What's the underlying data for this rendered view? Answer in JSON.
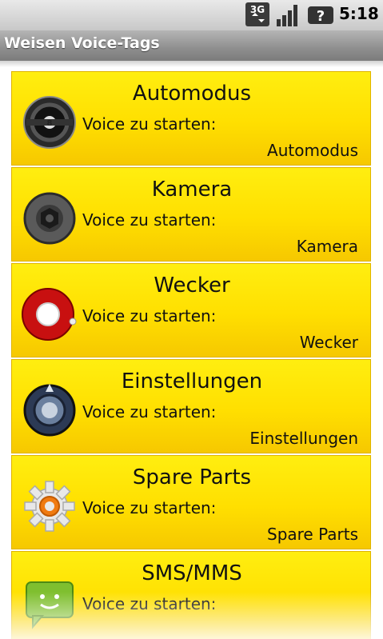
{
  "status_bar": {
    "network_icon": "3g-icon",
    "signal_icon": "signal-strength-icon",
    "unknown_icon": "question-mark-icon",
    "time": "5:18"
  },
  "app": {
    "title": "Weisen Voice-Tags"
  },
  "items": [
    {
      "title": "Automodus",
      "prompt": "Voice zu starten:",
      "tag": "Automodus",
      "icon": "steering-wheel-icon"
    },
    {
      "title": "Kamera",
      "prompt": "Voice zu starten:",
      "tag": "Kamera",
      "icon": "camera-icon"
    },
    {
      "title": "Wecker",
      "prompt": "Voice zu starten:",
      "tag": "Wecker",
      "icon": "alarm-clock-icon"
    },
    {
      "title": "Einstellungen",
      "prompt": "Voice zu starten:",
      "tag": "Einstellungen",
      "icon": "settings-icon"
    },
    {
      "title": "Spare Parts",
      "prompt": "Voice zu starten:",
      "tag": "Spare Parts",
      "icon": "gear-icon"
    },
    {
      "title": "SMS/MMS",
      "prompt": "Voice zu starten:",
      "tag": "",
      "icon": "message-icon"
    }
  ],
  "colors": {
    "item_background": "#ffdf00",
    "title_bar": "#8e8e8e"
  }
}
